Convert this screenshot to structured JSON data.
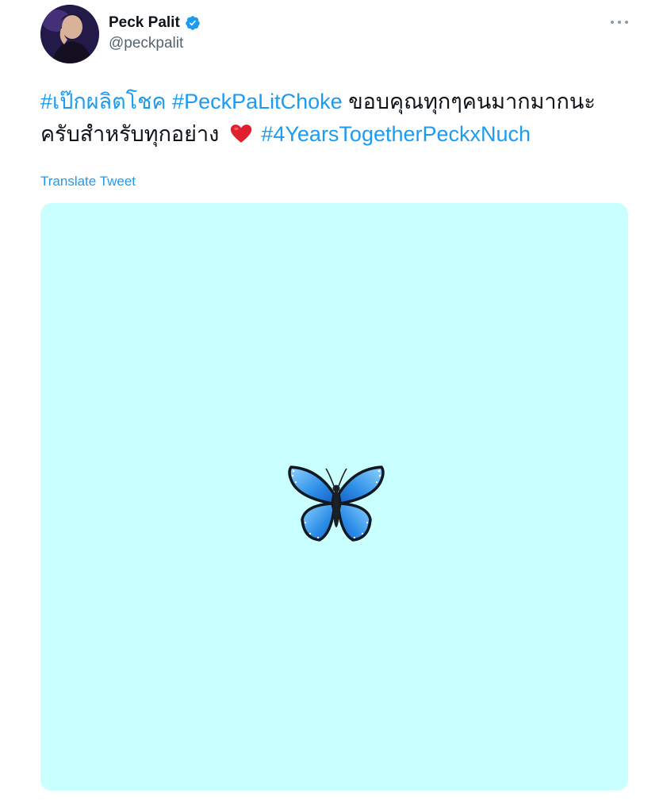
{
  "author": {
    "display_name": "Peck Palit",
    "handle": "@peckpalit",
    "verified": true,
    "avatar_icon": "profile-photo"
  },
  "tweet": {
    "tag_1": "#เป๊กผลิตโชค",
    "tag_2": "#PeckPaLitChoke",
    "text_1": "ขอบคุณทุกๆคนมากมากนะครับสำหรับทุกอย่าง",
    "emoji_icon": "red-heart-icon",
    "tag_3": "#4YearsTogetherPeckxNuch",
    "translate_label": "Translate Tweet"
  },
  "media": {
    "background_color": "#caffff",
    "content_icon": "blue-butterfly-icon"
  },
  "colors": {
    "link": "#1d9bf0",
    "text": "#0f1419",
    "secondary": "#536471"
  }
}
